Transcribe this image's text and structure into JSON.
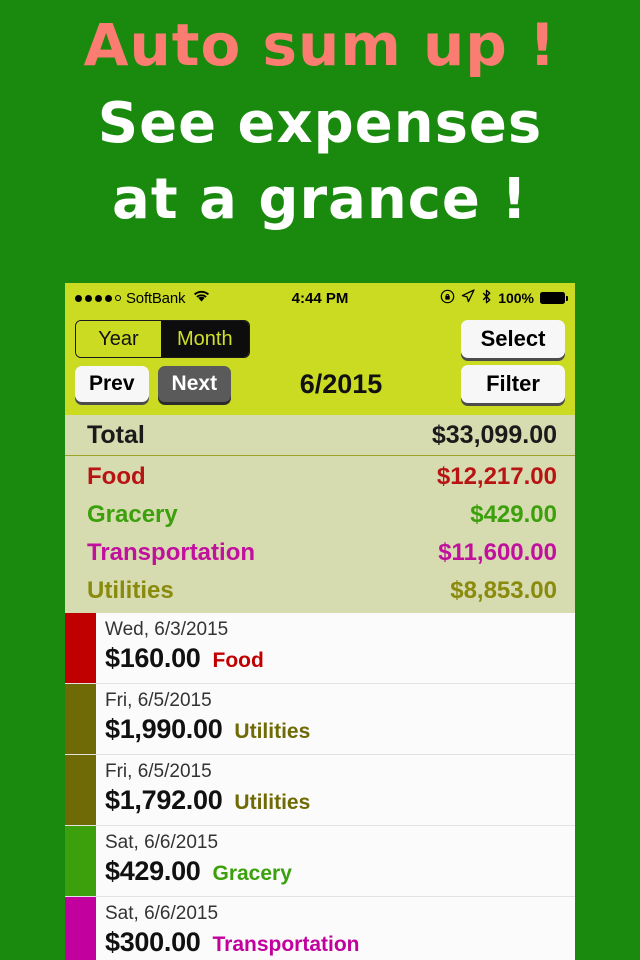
{
  "promo": {
    "line1": "Auto sum up !",
    "line2": "See expenses",
    "line3": "at a grance !",
    "color_accent": "#fb7d72",
    "color_text": "#ffffff",
    "background": "#1a8a0e"
  },
  "status_bar": {
    "carrier": "SoftBank",
    "signal_dots_filled": 4,
    "signal_dots_total": 5,
    "wifi_icon": "wifi-icon",
    "time": "4:44 PM",
    "rotation_lock_icon": "rotation-lock-icon",
    "location_icon": "location-arrow-icon",
    "bluetooth_icon": "bluetooth-icon",
    "battery_percent": "100%",
    "battery_icon": "battery-full-icon",
    "background": "#cadb22"
  },
  "toolbar": {
    "segmented": {
      "options": [
        "Year",
        "Month"
      ],
      "selected": "Month"
    },
    "prev_label": "Prev",
    "next_label": "Next",
    "next_disabled": true,
    "period_title": "6/2015",
    "select_label": "Select",
    "filter_label": "Filter"
  },
  "summary": {
    "total_label": "Total",
    "total_value": "$33,099.00",
    "rows": [
      {
        "label": "Food",
        "value": "$12,217.00",
        "color": "#b81414"
      },
      {
        "label": "Gracery",
        "value": "$429.00",
        "color": "#3ca00c"
      },
      {
        "label": "Transportation",
        "value": "$11,600.00",
        "color": "#c1109e"
      },
      {
        "label": "Utilities",
        "value": "$8,853.00",
        "color": "#8a8a0c"
      }
    ],
    "background": "#d6dbb0"
  },
  "transactions": [
    {
      "date": "Wed, 6/3/2015",
      "amount": "$160.00",
      "category": "Food",
      "color": "#c00000"
    },
    {
      "date": "Fri, 6/5/2015",
      "amount": "$1,990.00",
      "category": "Utilities",
      "color": "#6f6a06"
    },
    {
      "date": "Fri, 6/5/2015",
      "amount": "$1,792.00",
      "category": "Utilities",
      "color": "#6f6a06"
    },
    {
      "date": "Sat, 6/6/2015",
      "amount": "$429.00",
      "category": "Gracery",
      "color": "#3ca00c"
    },
    {
      "date": "Sat, 6/6/2015",
      "amount": "$300.00",
      "category": "Transportation",
      "color": "#c1009e"
    }
  ]
}
